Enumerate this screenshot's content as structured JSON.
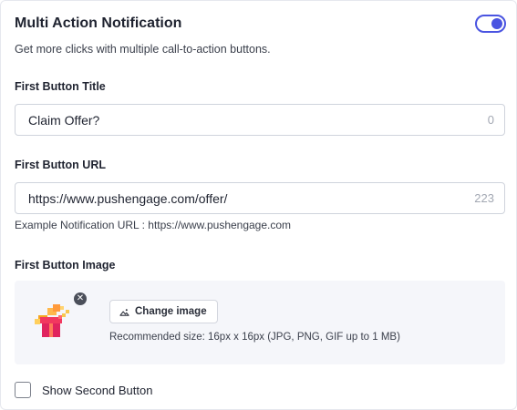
{
  "header": {
    "title": "Multi Action Notification",
    "subtitle": "Get more clicks with multiple call-to-action buttons.",
    "toggle_on": true,
    "accent_color": "#4a54e1"
  },
  "first_button_title": {
    "label": "First Button Title",
    "value": "Claim Offer?",
    "counter": "0"
  },
  "first_button_url": {
    "label": "First Button URL",
    "value": "https://www.pushengage.com/offer/",
    "counter": "223",
    "hint": "Example Notification URL : https://www.pushengage.com"
  },
  "first_button_image": {
    "label": "First Button Image",
    "image_icon": "gift-icon",
    "remove_icon": "close-icon",
    "change_button_label": "Change image",
    "change_button_icon": "image-icon",
    "recommended_size": "Recommended size: 16px x 16px (JPG, PNG, GIF up to 1 MB)"
  },
  "second_button": {
    "checkbox_label": "Show Second Button",
    "checked": false
  }
}
